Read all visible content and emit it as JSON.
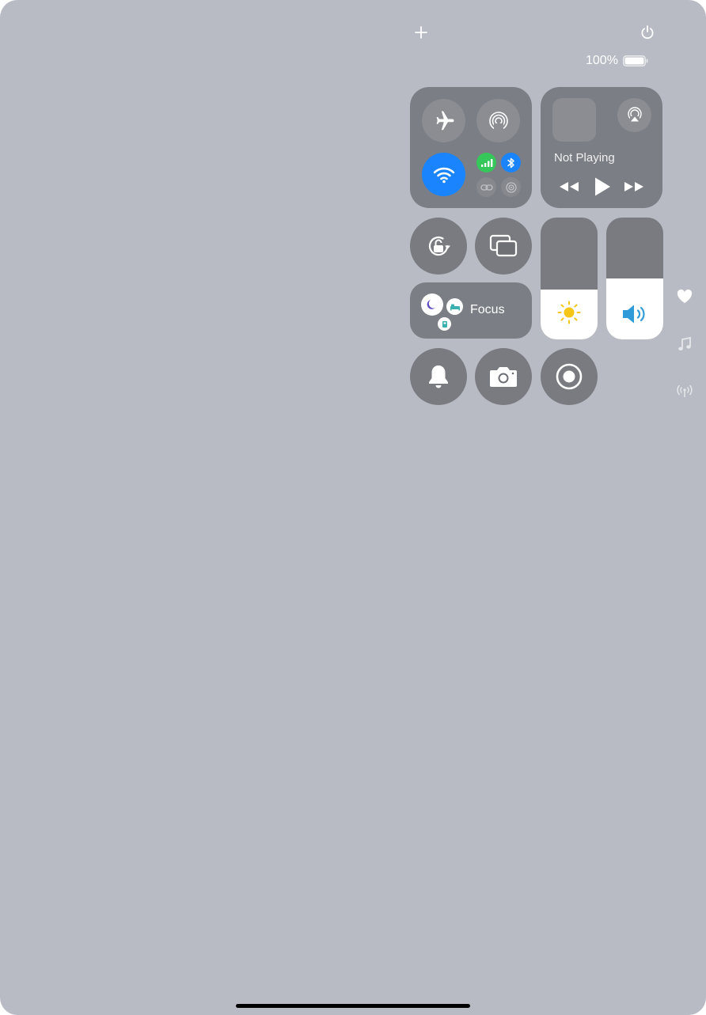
{
  "status": {
    "battery_percent": "100%",
    "battery_level": 1.0
  },
  "top_controls": {
    "add_icon": "plus-icon",
    "power_icon": "power-icon"
  },
  "connectivity": {
    "airplane_mode": "off",
    "airdrop": "off",
    "wifi": "on",
    "cellular": "on",
    "bluetooth": "on",
    "vpn": "off",
    "hotspot": "off"
  },
  "media": {
    "now_playing": "Not Playing",
    "controls": [
      "rewind",
      "play",
      "fast-forward"
    ]
  },
  "focus": {
    "label": "Focus"
  },
  "brightness": {
    "level": 0.41
  },
  "volume": {
    "level": 0.5
  },
  "side_pages": [
    "heart-icon",
    "music-note-icon",
    "antenna-icon"
  ],
  "colors": {
    "accent_blue": "#1a84ff",
    "cellular_green": "#35c759",
    "brightness_yellow": "#f5c518",
    "volume_blue": "#2f9bd8"
  }
}
